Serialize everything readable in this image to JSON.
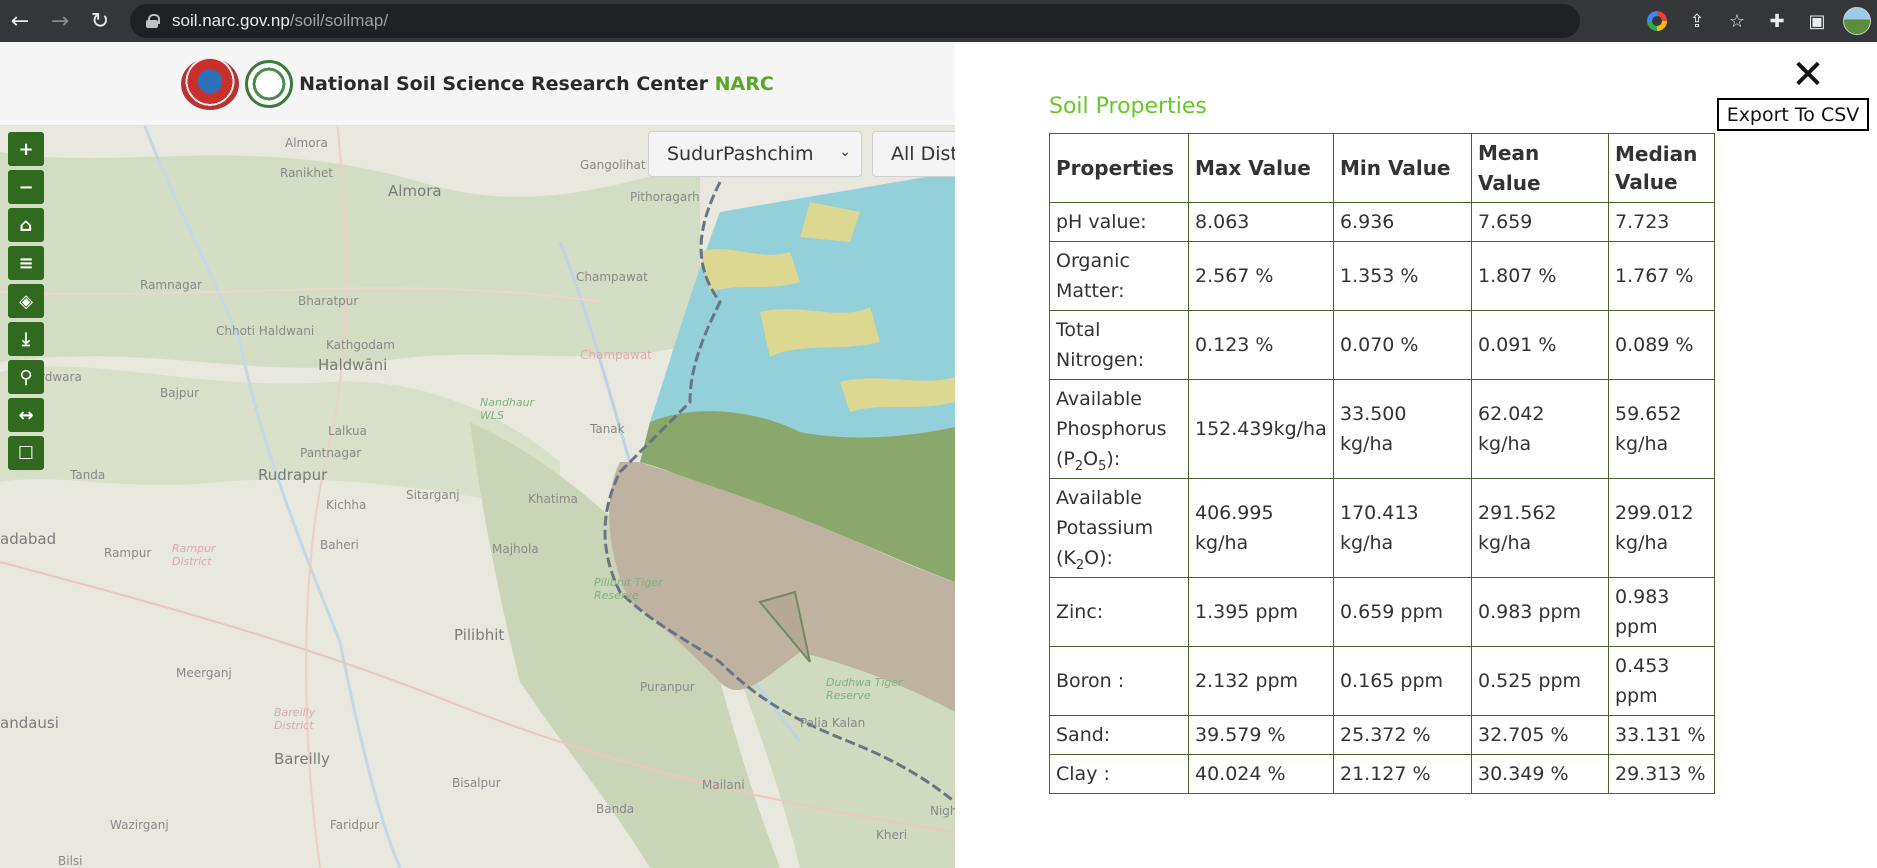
{
  "browser": {
    "url_host": "soil.narc.gov.np",
    "url_path": "/soil/soilmap/"
  },
  "site": {
    "title": "National Soil Science Research Center",
    "title_accent": "NARC"
  },
  "map": {
    "province_select": "SudurPashchim",
    "district_select": "All Dist",
    "tools": [
      "zoom-in-icon",
      "zoom-out-icon",
      "home-icon",
      "layers-list-icon",
      "dropbox-icon",
      "download-icon",
      "location-pin-icon",
      "measure-icon",
      "comment-icon"
    ],
    "places": {
      "almora_top": "Almora",
      "ranikhet": "Ranikhet",
      "almora": "Almora",
      "gangolihat": "Gangolihat",
      "pithoragarh": "Pithoragarh",
      "ramnagar": "Ramnagar",
      "bharatpur": "Bharatpur",
      "champawat": "Champawat",
      "champawat_district": "Champawat",
      "chhoti_haldwani": "Chhoti Haldwani",
      "kathgodam": "Kathgodam",
      "haldwani": "Haldwāni",
      "rdwara": "rdwara",
      "bajpur": "Bajpur",
      "nandhaur": "Nandhaur WLS",
      "tanakpur": "Tanak",
      "lalkua": "Lalkua",
      "pantnagar": "Pantnagar",
      "rudrapur": "Rudrapur",
      "tanda": "Tanda",
      "sitarganj": "Sitarganj",
      "khatima": "Khatima",
      "kichha": "Kichha",
      "adabad": "adabad",
      "rampur": "Rampur",
      "rampur_district": "Rampur District",
      "baheri": "Baheri",
      "majhola": "Majhola",
      "pilibhit_tiger": "Pilibhit Tiger Reserve",
      "pilibhit": "Pilibhit",
      "meerganj": "Meerganj",
      "puranpur": "Puranpur",
      "dudhwa": "Dudhwa Tiger Reserve",
      "bareilly_district": "Bareilly District",
      "palia_kalan": "Palia Kalan",
      "andausi": "andausi",
      "bareilly": "Bareilly",
      "bisalpur": "Bisalpur",
      "mailani": "Mailani",
      "wazirganj": "Wazirganj",
      "faridpur": "Faridpur",
      "banda": "Banda",
      "kheri": "Kheri",
      "nigh": "Nigh",
      "bilsi": "Bilsi"
    }
  },
  "panel": {
    "title": "Soil Properties",
    "export_label": "Export To CSV",
    "close_label": "✕",
    "headers": [
      "Properties",
      "Max Value",
      "Min Value",
      "Mean Value",
      "Median Value"
    ],
    "rows": [
      {
        "label": "pH value:",
        "max": "8.063",
        "min": "6.936",
        "mean": "7.659",
        "median": "7.723"
      },
      {
        "label": "Organic Matter:",
        "max": "2.567 %",
        "min": "1.353 %",
        "mean": "1.807 %",
        "median": "1.767 %"
      },
      {
        "label": "Total Nitrogen:",
        "max": "0.123 %",
        "min": "0.070 %",
        "mean": "0.091 %",
        "median": "0.089 %"
      },
      {
        "label_a": "Available Phosphorus (P",
        "sub1": "2",
        "mid": "O",
        "sub2": "5",
        "label_b": "):",
        "max": "152.439kg/ha",
        "min": "33.500 kg/ha",
        "mean": "62.042 kg/ha",
        "median": "59.652 kg/ha"
      },
      {
        "label_a": "Available Potassium (K",
        "sub1": "2",
        "label_b": "O):",
        "max": "406.995 kg/ha",
        "min": "170.413 kg/ha",
        "mean": "291.562 kg/ha",
        "median": "299.012 kg/ha"
      },
      {
        "label": "Zinc:",
        "max": "1.395 ppm",
        "min": "0.659 ppm",
        "mean": "0.983 ppm",
        "median": "0.983 ppm"
      },
      {
        "label": "Boron :",
        "max": "2.132 ppm",
        "min": "0.165 ppm",
        "mean": "0.525 ppm",
        "median": "0.453 ppm"
      },
      {
        "label": "Sand:",
        "max": "39.579 %",
        "min": "25.372 %",
        "mean": "32.705 %",
        "median": "33.131 %"
      },
      {
        "label": "Clay :",
        "max": "40.024 %",
        "min": "21.127 %",
        "mean": "30.349 %",
        "median": "29.313 %"
      }
    ]
  }
}
